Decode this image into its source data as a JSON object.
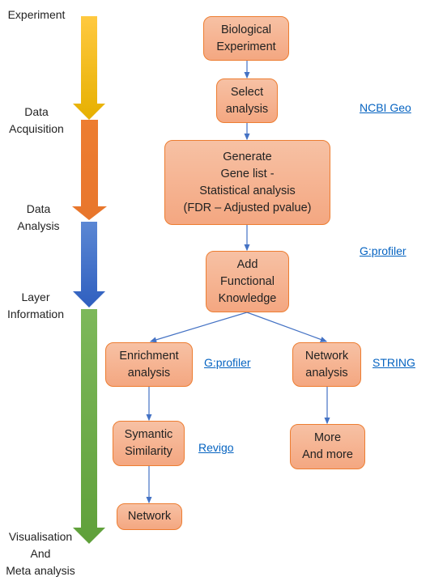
{
  "stages": [
    {
      "label": "Experiment",
      "color_top": "#ffc940",
      "color_bottom": "#e6b000"
    },
    {
      "label": "Data\nAcquisition",
      "color_top": "#ed7d31",
      "color_bottom": "#e8762c"
    },
    {
      "label": "Data\nAnalysis",
      "color_top": "#5b87d4",
      "color_bottom": "#2f5fbf"
    },
    {
      "label": "Layer\nInformation",
      "color_top": "#7db85a",
      "color_bottom": "#5fa03a"
    },
    {
      "label": "Visualisation\nAnd\nMeta analysis"
    }
  ],
  "boxes": {
    "bio": "Biological\nExperiment",
    "select": "Select\nanalysis",
    "generate": "Generate\nGene list -\nStatistical analysis\n(FDR – Adjusted pvalue)",
    "functional": "Add\nFunctional\nKnowledge",
    "enrichment": "Enrichment\nanalysis",
    "network_analysis": "Network\nanalysis",
    "semantic": "Symantic\nSimilarity",
    "more": "More\nAnd more",
    "network": "Network"
  },
  "links": {
    "ncbi": "NCBI Geo",
    "gprofiler1": "G:profiler",
    "gprofiler2": "G:profiler",
    "string": "STRING",
    "revigo": "Revigo"
  },
  "colors": {
    "box_border": "#ed7d31",
    "connector": "#4472c4",
    "link": "#0563c1"
  }
}
